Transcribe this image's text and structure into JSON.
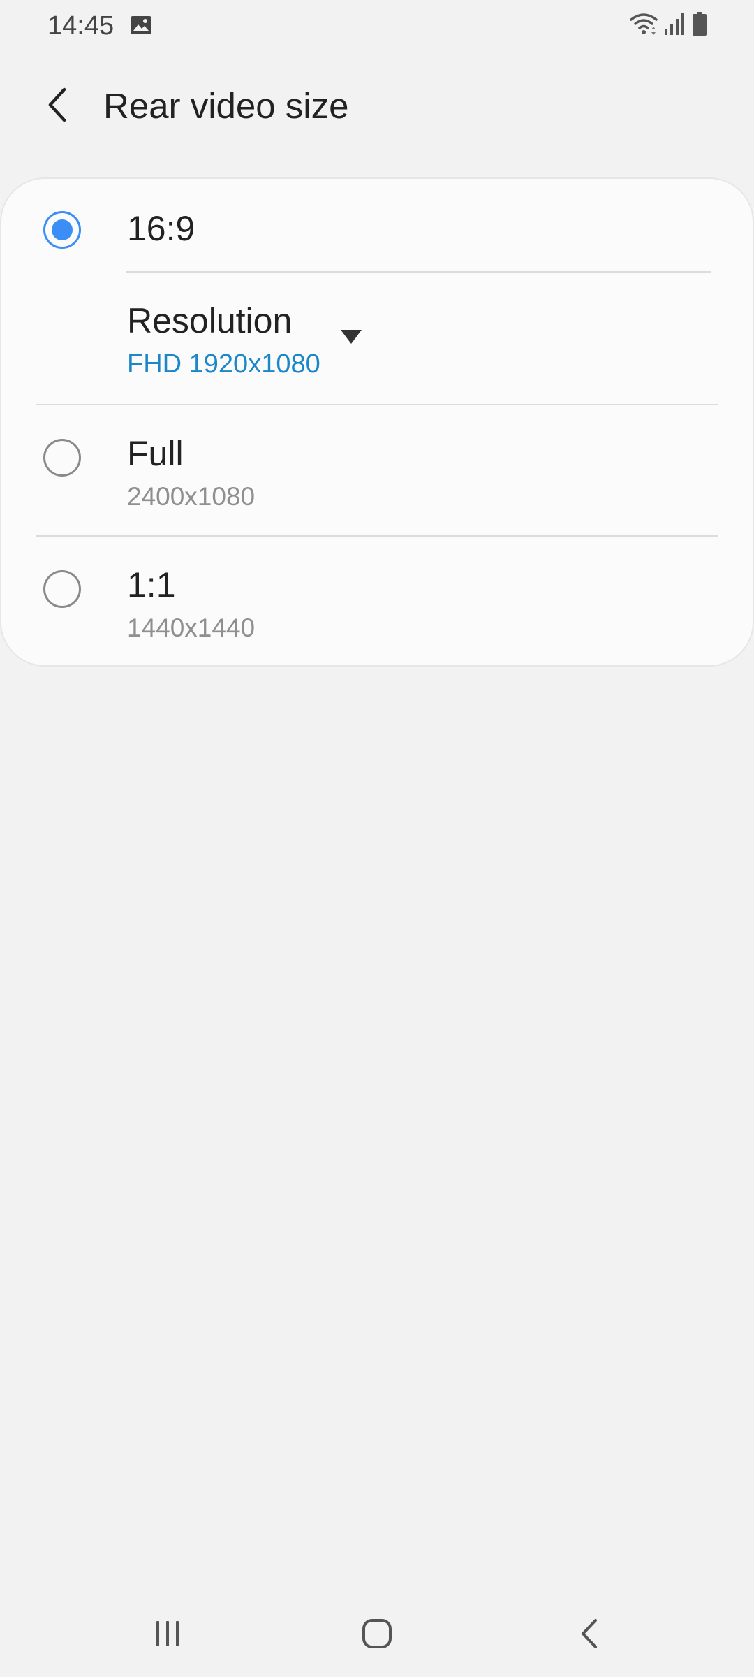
{
  "status_bar": {
    "time": "14:45",
    "icons": [
      "gallery-icon",
      "wifi-icon",
      "signal-icon",
      "battery-icon"
    ]
  },
  "header": {
    "title": "Rear video size",
    "back_icon": "chevron-left-icon"
  },
  "options": [
    {
      "title": "16:9",
      "subtitle": "",
      "selected": true
    },
    {
      "title": "Full",
      "subtitle": "2400x1080",
      "selected": false
    },
    {
      "title": "1:1",
      "subtitle": "1440x1440",
      "selected": false
    }
  ],
  "resolution": {
    "label": "Resolution",
    "value": "FHD 1920x1080",
    "icon": "dropdown-triangle-icon"
  },
  "colors": {
    "accent": "#3b8ef5",
    "resolution_value": "#1b87c9",
    "background": "#f2f2f2",
    "card": "#fbfbfb"
  },
  "nav_bar": {
    "icons": [
      "recent-apps-icon",
      "home-icon",
      "back-icon"
    ]
  }
}
